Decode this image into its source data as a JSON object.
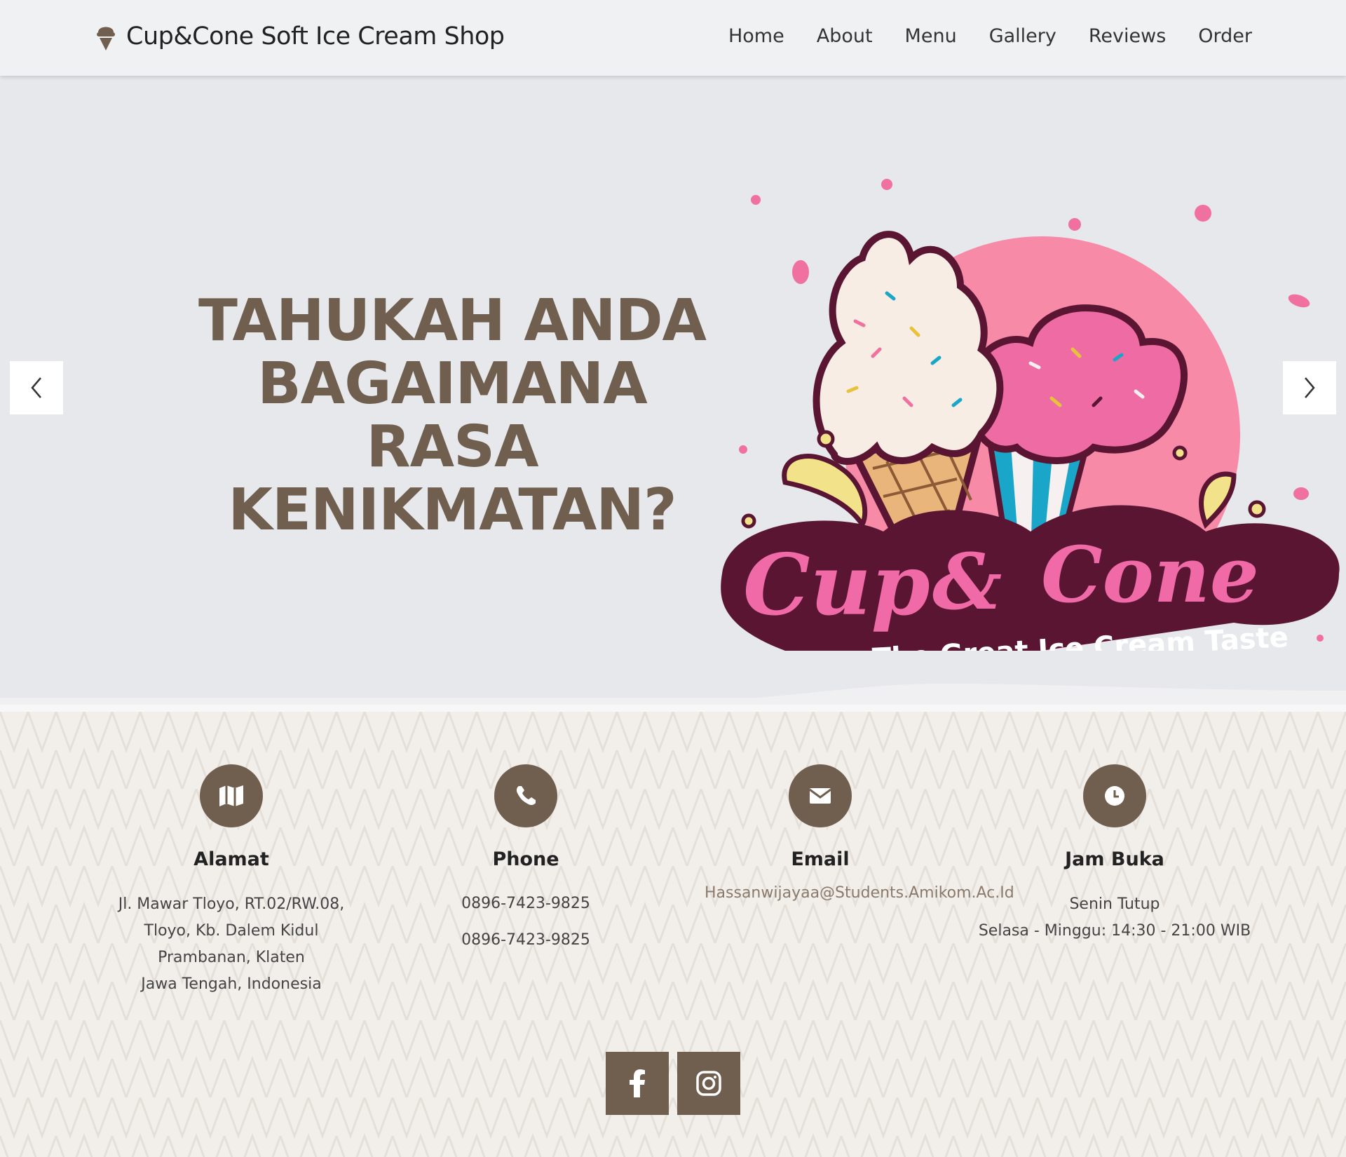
{
  "navbar": {
    "brand": "Cup&Cone Soft Ice Cream Shop",
    "brand_icon": "ice-cream-icon",
    "links": [
      "Home",
      "About",
      "Menu",
      "Gallery",
      "Reviews",
      "Order"
    ]
  },
  "hero": {
    "title_lines": [
      "TAHUKAH ANDA",
      "BAGAIMANA RASA",
      "KENIKMATAN?"
    ],
    "logo": {
      "word1": "Cup",
      "amp": "&",
      "word2": "Cone",
      "tagline": "The Great Ice Cream Taste"
    },
    "prev_icon": "chevron-left-icon",
    "next_icon": "chevron-right-icon"
  },
  "contact": {
    "address": {
      "icon": "map-icon",
      "title": "Alamat",
      "lines": [
        "Jl. Mawar Tloyo, RT.02/RW.08,",
        "Tloyo, Kb. Dalem Kidul",
        "Prambanan, Klaten",
        "Jawa Tengah, Indonesia"
      ]
    },
    "phone": {
      "icon": "phone-icon",
      "title": "Phone",
      "numbers": [
        "0896-7423-9825",
        "0896-7423-9825"
      ]
    },
    "email": {
      "icon": "envelope-icon",
      "title": "Email",
      "address": "Hassanwijayaa@Students.Amikom.Ac.Id"
    },
    "hours": {
      "icon": "clock-icon",
      "title": "Jam Buka",
      "lines": [
        "Senin Tutup",
        "Selasa - Minggu: 14:30 - 21:00 WIB"
      ]
    }
  },
  "social": {
    "facebook_icon": "facebook-icon",
    "instagram_icon": "instagram-icon"
  },
  "colors": {
    "accent": "#705f4f",
    "nav_bg": "#f0f1f3",
    "hero_bg": "#e6e8ec",
    "logo_pink": "#ef6aa6",
    "logo_maroon": "#5a1533"
  }
}
